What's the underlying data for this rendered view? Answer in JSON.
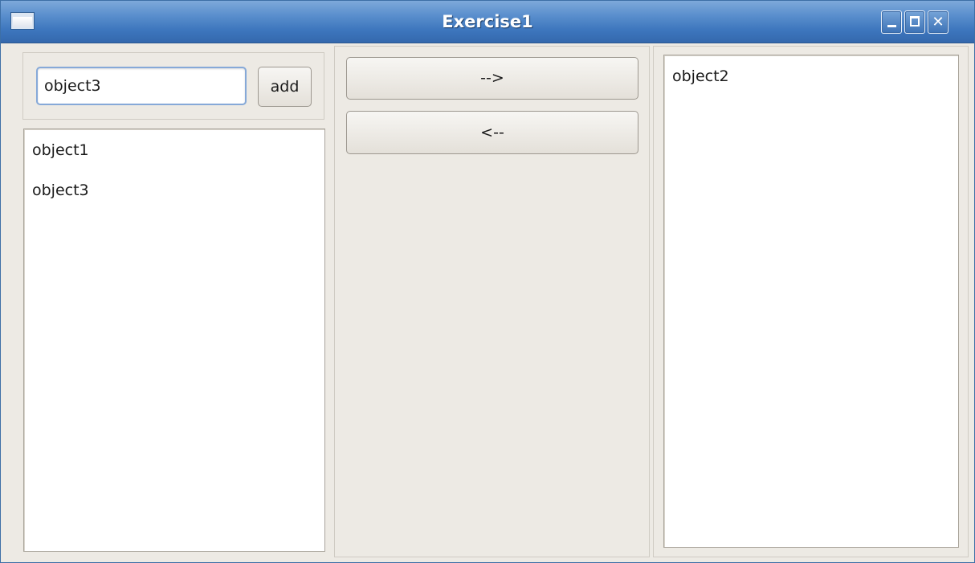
{
  "window": {
    "title": "Exercise1",
    "controls": {
      "minimize_icon": "minimize-icon",
      "maximize_icon": "maximize-icon",
      "close_icon": "close-icon"
    }
  },
  "input": {
    "value": "object3"
  },
  "buttons": {
    "add": "add",
    "move_right": "-->",
    "move_left": "<--"
  },
  "left_list": {
    "items": [
      "object1",
      "object3"
    ]
  },
  "right_list": {
    "items": [
      "object2"
    ]
  },
  "colors": {
    "titlebar": "#3d76bd",
    "window_bg": "#edeae4",
    "input_focus_border": "#86a9d8"
  }
}
